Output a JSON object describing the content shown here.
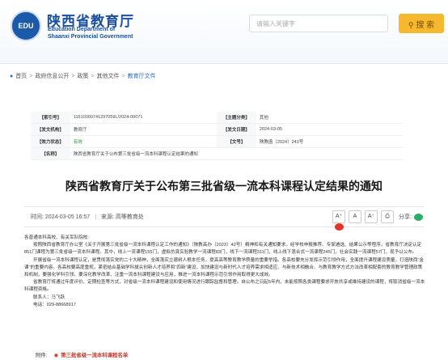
{
  "header": {
    "emblem_text": "EDU",
    "title_cn": "陕西省教育厅",
    "title_en_1": "Education Department of",
    "title_en_2": "Shaanxi Provincial Government",
    "search_placeholder": "请输入关键字",
    "search_button": "搜 索"
  },
  "breadcrumb": {
    "home": "首页",
    "l1": "政府信息公开",
    "l2": "政策",
    "l3": "其他文件",
    "current": "教育厅文件",
    "sep": ">"
  },
  "meta": {
    "index_label": "【索引号】",
    "index_value": "11610000741297059L/2024-00071",
    "category_label": "【主题分类】",
    "category_value": "其他",
    "issuer_label": "【发文机构】",
    "issuer_value": "教育厅",
    "date_label": "【发文日期】",
    "date_value": "2024-03-05",
    "status_label": "【效力状态】",
    "status_value": "有效",
    "docno_label": "【文号】",
    "docno_value": "陕教函〔2024〕243号",
    "name_label": "【名称】",
    "name_value": "陕西省教育厅关于公布第三批省级一流本科课程认定结果的通知"
  },
  "article": {
    "title": "陕西省教育厅关于公布第三批省级一流本科课程认定结果的通知",
    "time_label": "时间:",
    "time_value": "2024-03-05 16:57",
    "source_label": "来源:",
    "source_value": "高等教育处",
    "pipe": "|",
    "font_large": "A⁺",
    "font_normal": "A",
    "font_small": "A⁻",
    "print_icon_glyph": "⎙",
    "share_label": "分享:",
    "greeting": "各普通本科高校、有关军队院校:",
    "p1": "按照陕西省教育厅办公室《关于开展第三批省级一流本科课程认定工作的通知》（陕教高办〔2023〕42号）精神和有关通知要求，经学校申报推荐、专家遴选、结果公示等程序，省教育厅决定认定851门课程为第三批省级一流本科课程。其中，线上一流课程155门，虚拟仿真实验教学一流课程83门，线下一流课程311门，线上线下混合式一流课程245门，社会实践一流课程57门，现予以公布。",
    "p2": "开展省级一流本科课程认定，是贯彻落实党的二十大精神，全面落实立德树人根本任务，提高高等教育教学质量的重要举措。各高校要充分发挥示范引领作用，全面提升课程建设质量，打造陕西“金课”的重要内容。各高校要高度重视，紧密结合基础学科拔尖创新人才培养和“四新”建设，加快建设与新时代人才培养需求相适应、与新技术相融合、与教育教学方式方法改革相配套的教育教学管理政策和机制，要强化学科引领、要深化教学改革、注重一流本科课程建设与应用，推进一流本科课程示范引领作用取得更大成效。",
    "p3": "省教育厅将通过年度评价、定期检查等方式，对省级一流本科课程建设和使用情况进行跟踪监督和管理。自公布之日起5年内，未能按照各类课程要求开放共享或维持建设的课程，将取消省级一流本科课程资格。",
    "contact_line": "联系人：马飞跃",
    "phone_line": "电话：029-88668917",
    "attachment_label": "附件:",
    "attachment_file": "第三批省级一流本科课程名单"
  }
}
